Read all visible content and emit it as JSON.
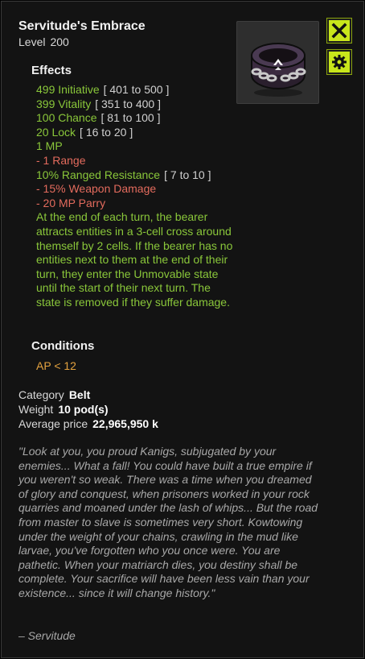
{
  "item": {
    "name": "Servitude's Embrace",
    "level_label": "Level",
    "level_value": "200",
    "image": "belt-chain-icon"
  },
  "buttons": {
    "close": "close-icon",
    "settings": "gear-icon",
    "accent": "#c8e61b"
  },
  "effects": {
    "heading": "Effects",
    "lines": [
      {
        "text": "499 Initiative",
        "range": "[ 401 to 500 ]",
        "tone": "pos"
      },
      {
        "text": "399 Vitality",
        "range": "[ 351 to 400 ]",
        "tone": "pos"
      },
      {
        "text": "100 Chance",
        "range": "[ 81 to 100 ]",
        "tone": "pos"
      },
      {
        "text": "20 Lock",
        "range": "[ 16 to 20 ]",
        "tone": "pos"
      },
      {
        "text": "1 MP",
        "range": "",
        "tone": "pos"
      },
      {
        "text": "- 1 Range",
        "range": "",
        "tone": "neg"
      },
      {
        "text": "10% Ranged Resistance",
        "range": "[ 7 to 10 ]",
        "tone": "pos"
      },
      {
        "text": "- 15% Weapon Damage",
        "range": "",
        "tone": "neg"
      },
      {
        "text": "- 20 MP Parry",
        "range": "",
        "tone": "neg"
      }
    ],
    "special": "At the end of each turn, the bearer attracts entities in a 3-cell cross around themself by 2 cells. If the bearer has no entities next to them at the end of their turn, they enter the Unmovable state until the start of their next turn. The state is removed if they suffer damage."
  },
  "conditions": {
    "heading": "Conditions",
    "value": "AP < 12"
  },
  "details": {
    "category_label": "Category",
    "category_value": "Belt",
    "weight_label": "Weight",
    "weight_value": "10 pod(s)",
    "price_label": "Average price",
    "price_value": "22,965,950 k"
  },
  "lore": {
    "text": "\"Look at you, you proud Kanigs, subjugated by your enemies... What a fall! You could have built a true empire if you weren't so weak. There was a time when you dreamed of glory and conquest, when prisoners worked in your rock quarries and moaned under the lash of whips... But the road from master to slave is sometimes very short. Kowtowing under the weight of your chains, crawling in the mud like larvae, you've forgotten who you once were. You are pathetic. When your matriarch dies, you destiny shall be complete. Your sacrifice will have been less vain than your existence... since it will change history.\"",
    "signature": "– Servitude"
  },
  "colors": {
    "positive": "#8ac73a",
    "negative": "#e36b5d",
    "condition": "#e4a23f"
  }
}
